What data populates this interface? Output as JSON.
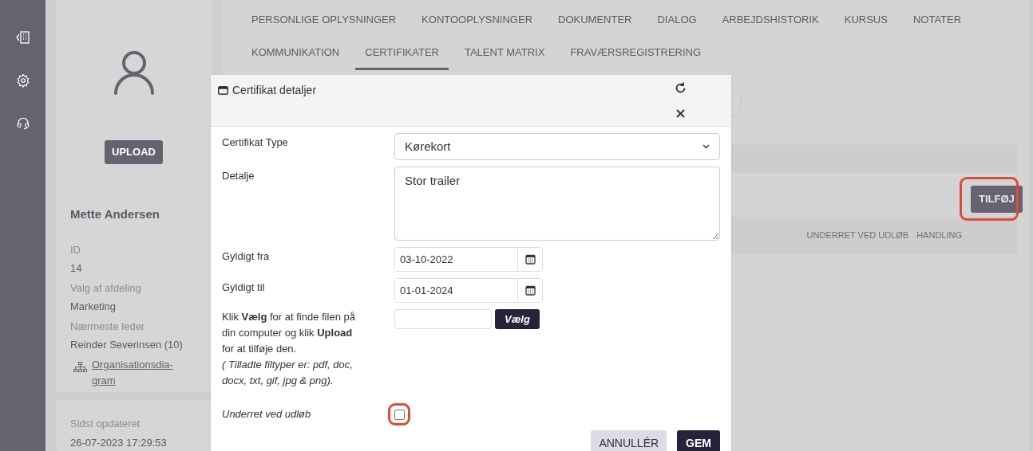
{
  "profile": {
    "upload_button": "UPLOAD",
    "name": "Mette Andersen",
    "fields": [
      {
        "label": "ID",
        "value": "14"
      },
      {
        "label": "Valg af afdeling",
        "value": "Marketing"
      },
      {
        "label": "Nærmeste leder",
        "value": "Reinder Severinsen (10)"
      }
    ],
    "org_chart_link": "Organisationsdia-gram"
  },
  "last_updated": {
    "label": "Sidst opdateret",
    "value": "26-07-2023 17:29:53"
  },
  "tabs": [
    {
      "label": "PERSONLIGE OPLYSNINGER",
      "selected": false
    },
    {
      "label": "KONTOOPLYSNINGER",
      "selected": false
    },
    {
      "label": "DOKUMENTER",
      "selected": false
    },
    {
      "label": "DIALOG",
      "selected": false
    },
    {
      "label": "ARBEJDSHISTORIK",
      "selected": false
    },
    {
      "label": "KURSUS",
      "selected": false
    },
    {
      "label": "NOTATER",
      "selected": false
    },
    {
      "label": "KOMMUNIKATION",
      "selected": false
    },
    {
      "label": "CERTIFIKATER",
      "selected": true
    },
    {
      "label": "TALENT MATRIX",
      "selected": false
    },
    {
      "label": "FRAVÆRSREGISTRERING",
      "selected": false
    }
  ],
  "add_button": {
    "label": "TILFØJ",
    "highlighted": true
  },
  "table": {
    "columns": [
      "UNDERRET VED UDLØB",
      "HANDLING"
    ]
  },
  "dialog": {
    "title": "Certifikat detaljer",
    "fields": [
      {
        "kind": "select",
        "label": "Certifikat Type",
        "value": "Kørekort"
      },
      {
        "kind": "textarea",
        "label": "Detalje",
        "value": "Stor trailer"
      },
      {
        "kind": "date",
        "label": "Gyldigt fra",
        "value": "03-10-2022"
      },
      {
        "kind": "date",
        "label": "Gyldigt til",
        "value": "01-01-2024"
      },
      {
        "kind": "file",
        "label": "Klik **Vælg** for at finde filen på din computer og klik **Upload** for at tilføje den.",
        "note": "( Tilladte filtyper er: pdf, doc, docx, txt, gif, jpg & png).",
        "button": "Vælg"
      },
      {
        "kind": "checkbox",
        "label": "Underret ved udløb",
        "checked": false,
        "highlighted": true
      }
    ],
    "buttons": [
      {
        "kind": "secondary",
        "label": "ANNULLÉR"
      },
      {
        "kind": "primary",
        "label": "GEM"
      }
    ]
  }
}
